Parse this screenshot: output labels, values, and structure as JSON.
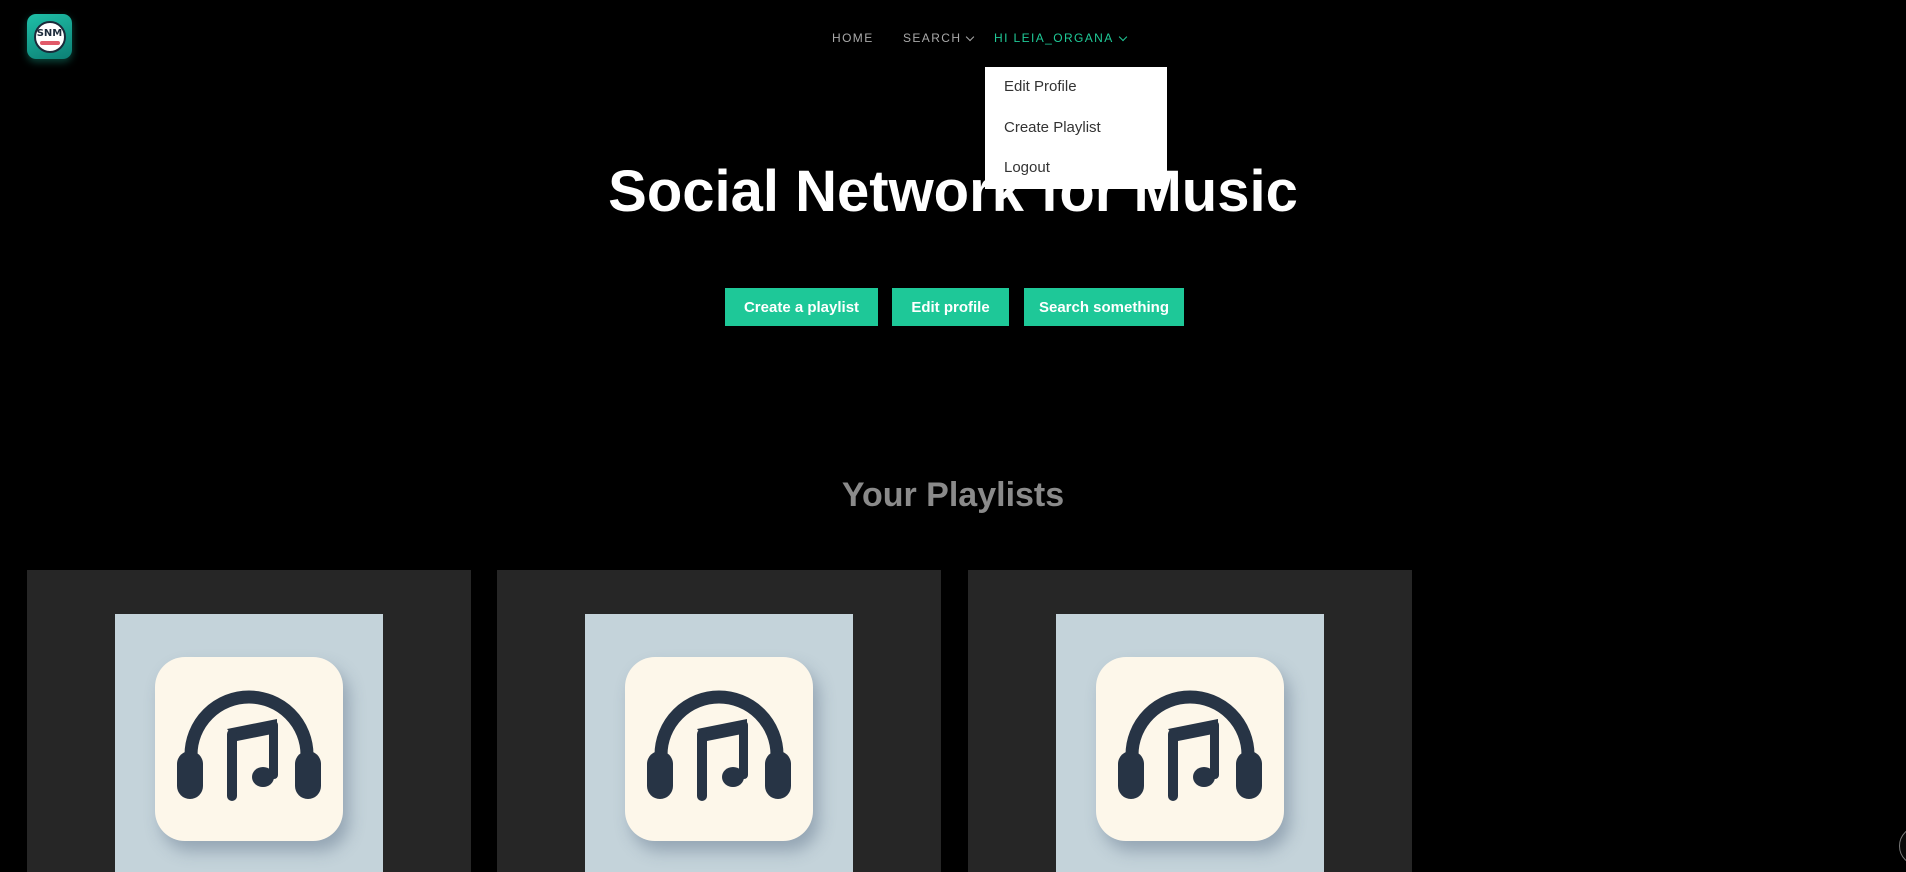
{
  "app": {
    "logo_text": "SNM"
  },
  "nav": {
    "home": "HOME",
    "search": "SEARCH",
    "user": "HI LEIA_ORGANA"
  },
  "user_menu": {
    "items": [
      "Edit Profile",
      "Create Playlist",
      "Logout"
    ]
  },
  "hero": {
    "title": "Social Network for Music",
    "buttons": {
      "create": "Create a playlist",
      "edit": "Edit profile",
      "search": "Search something"
    }
  },
  "playlists": {
    "heading": "Your Playlists",
    "cards": [
      {
        "icon": "headphones-music-note-icon"
      },
      {
        "icon": "headphones-music-note-icon"
      },
      {
        "icon": "headphones-music-note-icon"
      }
    ]
  },
  "colors": {
    "accent": "#1ec898",
    "background": "#000000",
    "card": "#262626",
    "nav_text": "#a9a9a9",
    "nav_active": "#1fc997"
  }
}
